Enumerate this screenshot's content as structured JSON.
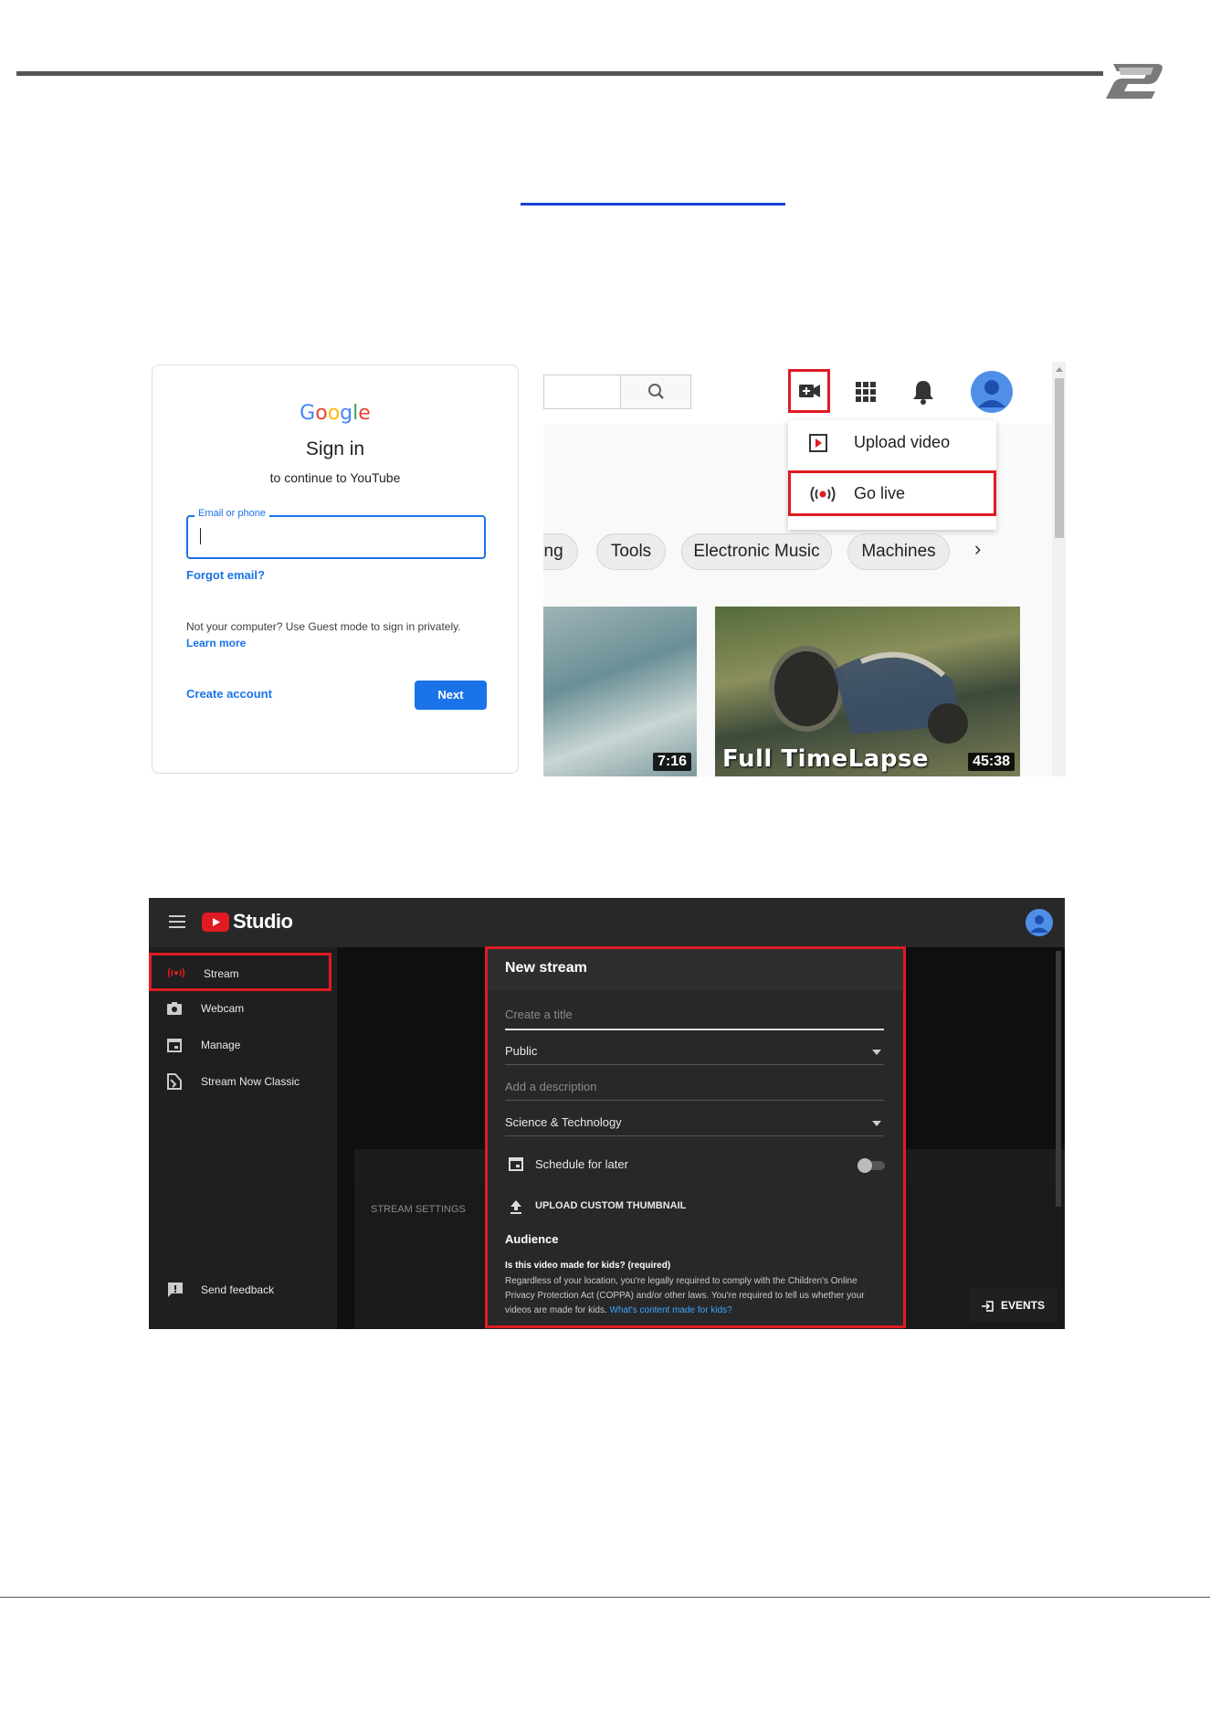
{
  "signin": {
    "logo": [
      "G",
      "o",
      "o",
      "g",
      "l",
      "e"
    ],
    "title": "Sign in",
    "subtitle": "to continue to YouTube",
    "email_label": "Email or phone",
    "forgot": "Forgot email?",
    "guest_text": "Not your computer? Use Guest mode to sign in privately.",
    "learn_more": "Learn more",
    "create_account": "Create account",
    "next": "Next"
  },
  "youtube": {
    "menu": {
      "upload": "Upload video",
      "go_live": "Go live"
    },
    "chips": [
      "ing",
      "Tools",
      "Electronic Music",
      "Machines"
    ],
    "chip_next": "›",
    "videos": [
      {
        "duration": "7:16",
        "title": ""
      },
      {
        "duration": "45:38",
        "title": "Full TimeLapse"
      }
    ]
  },
  "studio": {
    "brand": "Studio",
    "sidebar": [
      {
        "label": "Stream",
        "icon": "broadcast-icon"
      },
      {
        "label": "Webcam",
        "icon": "camera-icon"
      },
      {
        "label": "Manage",
        "icon": "calendar-icon"
      },
      {
        "label": "Stream Now Classic",
        "icon": "classic-icon"
      }
    ],
    "send_feedback": "Send feedback",
    "stream_settings": "STREAM SETTINGS",
    "events": "EVENTS",
    "modal": {
      "title": "New stream",
      "title_placeholder": "Create a title",
      "visibility": "Public",
      "description_placeholder": "Add a description",
      "category": "Science & Technology",
      "schedule": "Schedule for later",
      "thumbnail": "UPLOAD CUSTOM THUMBNAIL",
      "audience": "Audience",
      "kids_question": "Is this video made for kids? (required)",
      "kids_text": "Regardless of your location, you're legally required to comply with the Children's Online Privacy Protection Act (COPPA) and/or other laws. You're required to tell us whether your videos are made for kids.",
      "kids_link": "What's content made for kids?"
    }
  },
  "colors": {
    "accent_red": "#e01b22",
    "google_blue": "#1a73e8",
    "studio_bg": "#1f1f1f"
  }
}
